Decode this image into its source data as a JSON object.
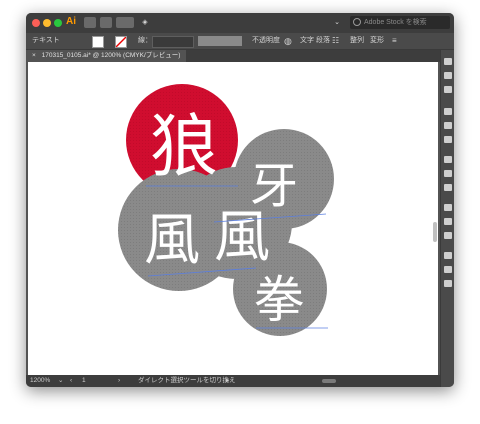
{
  "app": {
    "logo": "Ai"
  },
  "titlebar": {
    "search_placeholder": "Adobe Stock を検索"
  },
  "control_bar": {
    "tool_label": "テキスト",
    "stroke_label": "線：",
    "opacity_label": "不透明度",
    "character_label": "文字",
    "paragraph_label": "段落",
    "align_label": "整列",
    "transform_label": "変形"
  },
  "document": {
    "tab_title": "170315_0105.ai* @ 1200% (CMYK/プレビュー)",
    "close_glyph": "×"
  },
  "artwork": {
    "colors": {
      "accent": "#d00d2f",
      "circle": "#8a8a8a",
      "text": "#ffffff"
    },
    "glyphs": [
      "狼",
      "牙",
      "風",
      "風",
      "拳"
    ]
  },
  "statusbar": {
    "zoom": "1200%",
    "page": "1",
    "hint": "ダイレクト選択ツールを切り換え"
  }
}
